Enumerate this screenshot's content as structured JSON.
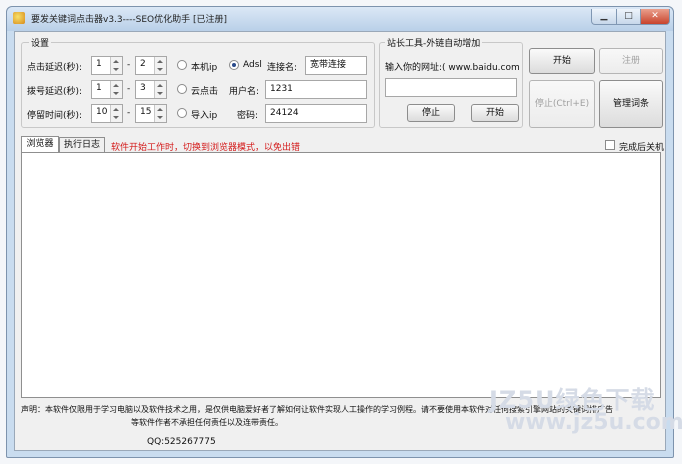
{
  "window": {
    "title": "要发关键词点击器v3.3----SEO优化助手 [已注册]",
    "min_glyph": "▁",
    "max_glyph": "□",
    "close_glyph": "✕"
  },
  "settings": {
    "group_label": "设置",
    "click_interval_label": "点击延迟(秒):",
    "dial_interval_label": "拨号延迟(秒):",
    "stay_time_label": "停留时间(秒):",
    "range_separator": "-",
    "click_interval": {
      "min": "1",
      "max": "2"
    },
    "dial_interval": {
      "min": "1",
      "max": "3"
    },
    "stay_time": {
      "min": "10",
      "max": "15"
    },
    "ip_local": "本机ip",
    "ip_cloud": "云点击",
    "ip_import": "导入ip",
    "adsl": "Adsl",
    "conn_name_label": "连接名:",
    "conn_name_value": "宽带连接",
    "username_label": "用户名:",
    "username_value": "1231",
    "password_label": "密码:",
    "password_value": "24124"
  },
  "tools": {
    "group_label": "站长工具-外链自动增加",
    "url_label": "输入你的网址:( www.baidu.com)",
    "url_value": "",
    "stop_label": "停止",
    "start_label": "开始"
  },
  "buttons": {
    "start": "开始",
    "register": "注册",
    "stop": "停止(Ctrl+E)",
    "manage_keywords": "管理词条"
  },
  "tabs": {
    "browser": "浏览器",
    "log": "执行日志",
    "warning": "软件开始工作时，切换到浏览器模式，以免出错",
    "shutdown_label": "完成后关机"
  },
  "footer": {
    "notice_line1": "声明：本软件仅限用于学习电脑以及软件技术之用，是仅供电脑爱好者了解如何让软件实现人工操作的学习例程。请不要使用本软件对任何搜索引擎网站的关键词排广告",
    "notice_line2": "等软件作者不承担任何责任以及连带责任。",
    "qq": "QQ:525267775"
  },
  "watermark": {
    "line1": "JZ5U绿色下载",
    "line2": "www.jz5u.com"
  }
}
